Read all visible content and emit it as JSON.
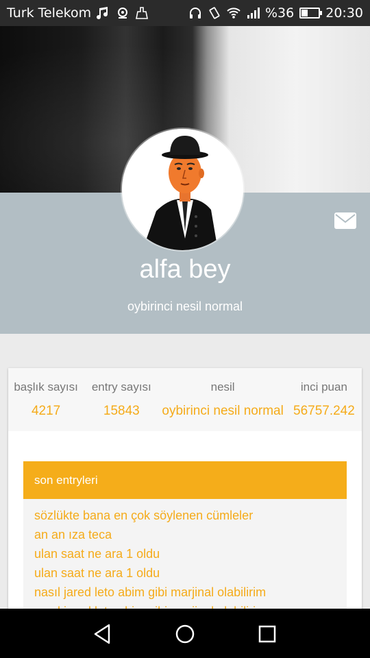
{
  "status_bar": {
    "carrier": "Turk Telekom",
    "battery_percent": "%36",
    "battery_level": 0.36,
    "time": "20:30",
    "icons_left": [
      "music-note-icon",
      "radio-icon",
      "cleaner-icon"
    ],
    "icons_right": [
      "headphones-icon",
      "vibrate-icon",
      "wifi-icon",
      "signal-icon",
      "battery-icon"
    ]
  },
  "profile": {
    "username": "alfa bey",
    "rank": "oybirinci nesil normal",
    "avatar": "avatar-bowler-hat-man",
    "message_icon": "mail-icon"
  },
  "stats": [
    {
      "label": "başlık sayısı",
      "value": "4217"
    },
    {
      "label": "entry sayısı",
      "value": "15843"
    },
    {
      "label": "nesil",
      "value": "oybirinci nesil normal"
    },
    {
      "label": "inci puan",
      "value": "56757.242"
    }
  ],
  "entries": {
    "title": "son entryleri",
    "items": [
      "sözlükte bana en çok söylenen cümleler",
      "an an ıza teca",
      "ulan saat ne ara 1 oldu",
      "ulan saat ne ara 1 oldu",
      "nasıl jared leto abim gibi marjinal olabilirim",
      "nasıl jared leto abim gibi marjinal olabilirim"
    ]
  },
  "navbar": {
    "back": "back-triangle-icon",
    "home": "home-circle-icon",
    "recents": "recents-square-icon"
  },
  "colors": {
    "accent": "#f5ab1a",
    "profile_band": "#b2bec4",
    "status_bar": "#2b2b2b"
  }
}
